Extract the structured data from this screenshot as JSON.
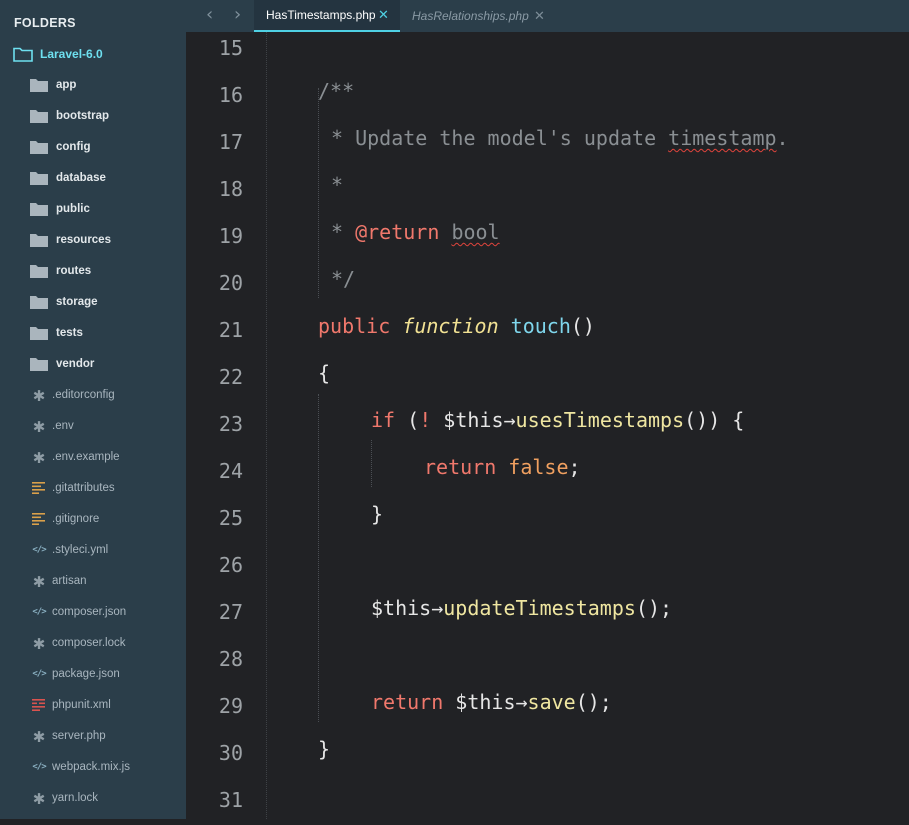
{
  "sidebar": {
    "title": "FOLDERS",
    "root": "Laravel-6.0",
    "folders": [
      "app",
      "bootstrap",
      "config",
      "database",
      "public",
      "resources",
      "routes",
      "storage",
      "tests",
      "vendor"
    ],
    "files": [
      {
        "name": ".editorconfig",
        "icon": "asterisk-icon"
      },
      {
        "name": ".env",
        "icon": "asterisk-icon"
      },
      {
        "name": ".env.example",
        "icon": "asterisk-icon"
      },
      {
        "name": ".gitattributes",
        "icon": "lines-icon"
      },
      {
        "name": ".gitignore",
        "icon": "lines-icon"
      },
      {
        "name": ".styleci.yml",
        "icon": "code-icon"
      },
      {
        "name": "artisan",
        "icon": "asterisk-icon"
      },
      {
        "name": "composer.json",
        "icon": "code-icon"
      },
      {
        "name": "composer.lock",
        "icon": "asterisk-icon"
      },
      {
        "name": "package.json",
        "icon": "code-icon"
      },
      {
        "name": "phpunit.xml",
        "icon": "xml-icon"
      },
      {
        "name": "server.php",
        "icon": "asterisk-icon"
      },
      {
        "name": "webpack.mix.js",
        "icon": "code-icon"
      },
      {
        "name": "yarn.lock",
        "icon": "asterisk-icon"
      }
    ]
  },
  "tabs": [
    {
      "label": "HasTimestamps.php",
      "close": "✕",
      "active": true
    },
    {
      "label": "HasRelationships.php",
      "close": "✕",
      "active": false
    }
  ],
  "nav": {
    "back": "‹",
    "forward": "›"
  },
  "editor": {
    "line_numbers": [
      "15",
      "16",
      "17",
      "18",
      "19",
      "20",
      "21",
      "22",
      "23",
      "24",
      "25",
      "26",
      "27",
      "28",
      "29",
      "30",
      "31"
    ],
    "code": {
      "l16": "/**",
      "l17_a": "* Update the model's update ",
      "l17_b": "timestamp",
      "l17_c": ".",
      "l18": "*",
      "l19_star": "* ",
      "l19_tag": "@return",
      "l19_sp": " ",
      "l19_type": "bool",
      "l20": "*/",
      "l21_public": "public",
      "l21_function": "function",
      "l21_name": "touch",
      "l21_parens": "()",
      "l22": "{",
      "l23_if": "if",
      "l23_open": " (",
      "l23_not": "!",
      "l23_this": " $this→",
      "l23_meth": "usesTimestamps",
      "l23_rest": "()) {",
      "l24_return": "return",
      "l24_false": "false",
      "l24_semi": ";",
      "l25": "}",
      "l27_this": "$this→",
      "l27_meth": "updateTimestamps",
      "l27_rest": "();",
      "l29_return": "return",
      "l29_this": " $this→",
      "l29_meth": "save",
      "l29_rest": "();",
      "l30": "}"
    }
  }
}
